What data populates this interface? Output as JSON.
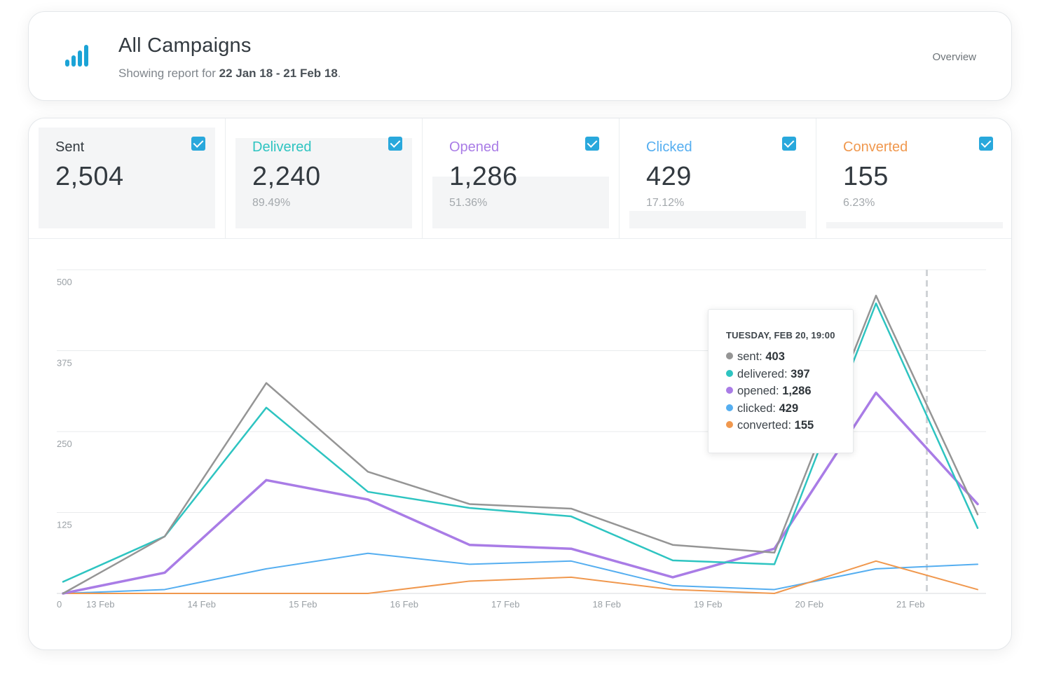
{
  "header": {
    "icon": "bar-chart-icon",
    "title": "All Campaigns",
    "subtitle_prefix": "Showing report for",
    "date_range": "22 Jan 18 - 21 Feb 18",
    "subtitle_suffix": ".",
    "overview_label": "Overview"
  },
  "colors": {
    "sent": "#959595",
    "delivered": "#2ec4c1",
    "opened": "#a97ce6",
    "clicked": "#55aef0",
    "converted": "#f0984e",
    "checkbox": "#29a8dc"
  },
  "stats": [
    {
      "key": "sent",
      "label": "Sent",
      "value": "2,504",
      "pct": "",
      "checked": true,
      "label_color": "#333a40",
      "fill": 1.0
    },
    {
      "key": "delivered",
      "label": "Delivered",
      "value": "2,240",
      "pct": "89.49%",
      "checked": true,
      "label_color": "#2ec4c1",
      "fill": 0.8949
    },
    {
      "key": "opened",
      "label": "Opened",
      "value": "1,286",
      "pct": "51.36%",
      "checked": true,
      "label_color": "#a97ce6",
      "fill": 0.5136
    },
    {
      "key": "clicked",
      "label": "Clicked",
      "value": "429",
      "pct": "17.12%",
      "checked": true,
      "label_color": "#55aef0",
      "fill": 0.1712
    },
    {
      "key": "converted",
      "label": "Converted",
      "value": "155",
      "pct": "6.23%",
      "checked": true,
      "label_color": "#f0984e",
      "fill": 0.0623
    }
  ],
  "tooltip": {
    "title": "TUESDAY, FEB 20, 19:00",
    "rows": [
      {
        "label": "sent:",
        "value": "403",
        "color": "#959595"
      },
      {
        "label": "delivered:",
        "value": "397",
        "color": "#2ec4c1"
      },
      {
        "label": "opened:",
        "value": "1,286",
        "color": "#a97ce6"
      },
      {
        "label": "clicked:",
        "value": "429",
        "color": "#55aef0"
      },
      {
        "label": "converted:",
        "value": "155",
        "color": "#f0984e"
      }
    ]
  },
  "chart_data": {
    "type": "line",
    "x_labels": [
      "13 Feb",
      "14 Feb",
      "15 Feb",
      "16 Feb",
      "17 Feb",
      "18 Feb",
      "19 Feb",
      "20 Feb",
      "21 Feb"
    ],
    "y_ticks": [
      0,
      125,
      250,
      375,
      500
    ],
    "ylim": [
      0,
      500
    ],
    "x": [
      0,
      1,
      2,
      3,
      4,
      5,
      6,
      7,
      8,
      9,
      10
    ],
    "highlight_x": 8.5,
    "grid": true,
    "series": [
      {
        "name": "sent",
        "values": [
          0,
          88,
          325,
          188,
          138,
          131,
          75,
          63,
          460,
          122
        ]
      },
      {
        "name": "delivered",
        "values": [
          18,
          88,
          287,
          157,
          132,
          119,
          51,
          45,
          448,
          101
        ]
      },
      {
        "name": "opened",
        "values": [
          0,
          32,
          175,
          145,
          75,
          69,
          25,
          69,
          310,
          138
        ]
      },
      {
        "name": "clicked",
        "values": [
          0,
          6,
          38,
          62,
          45,
          50,
          12,
          6,
          38,
          45
        ]
      },
      {
        "name": "converted",
        "values": [
          0,
          0,
          0,
          0,
          19,
          25,
          6,
          0,
          50,
          6
        ]
      }
    ]
  }
}
